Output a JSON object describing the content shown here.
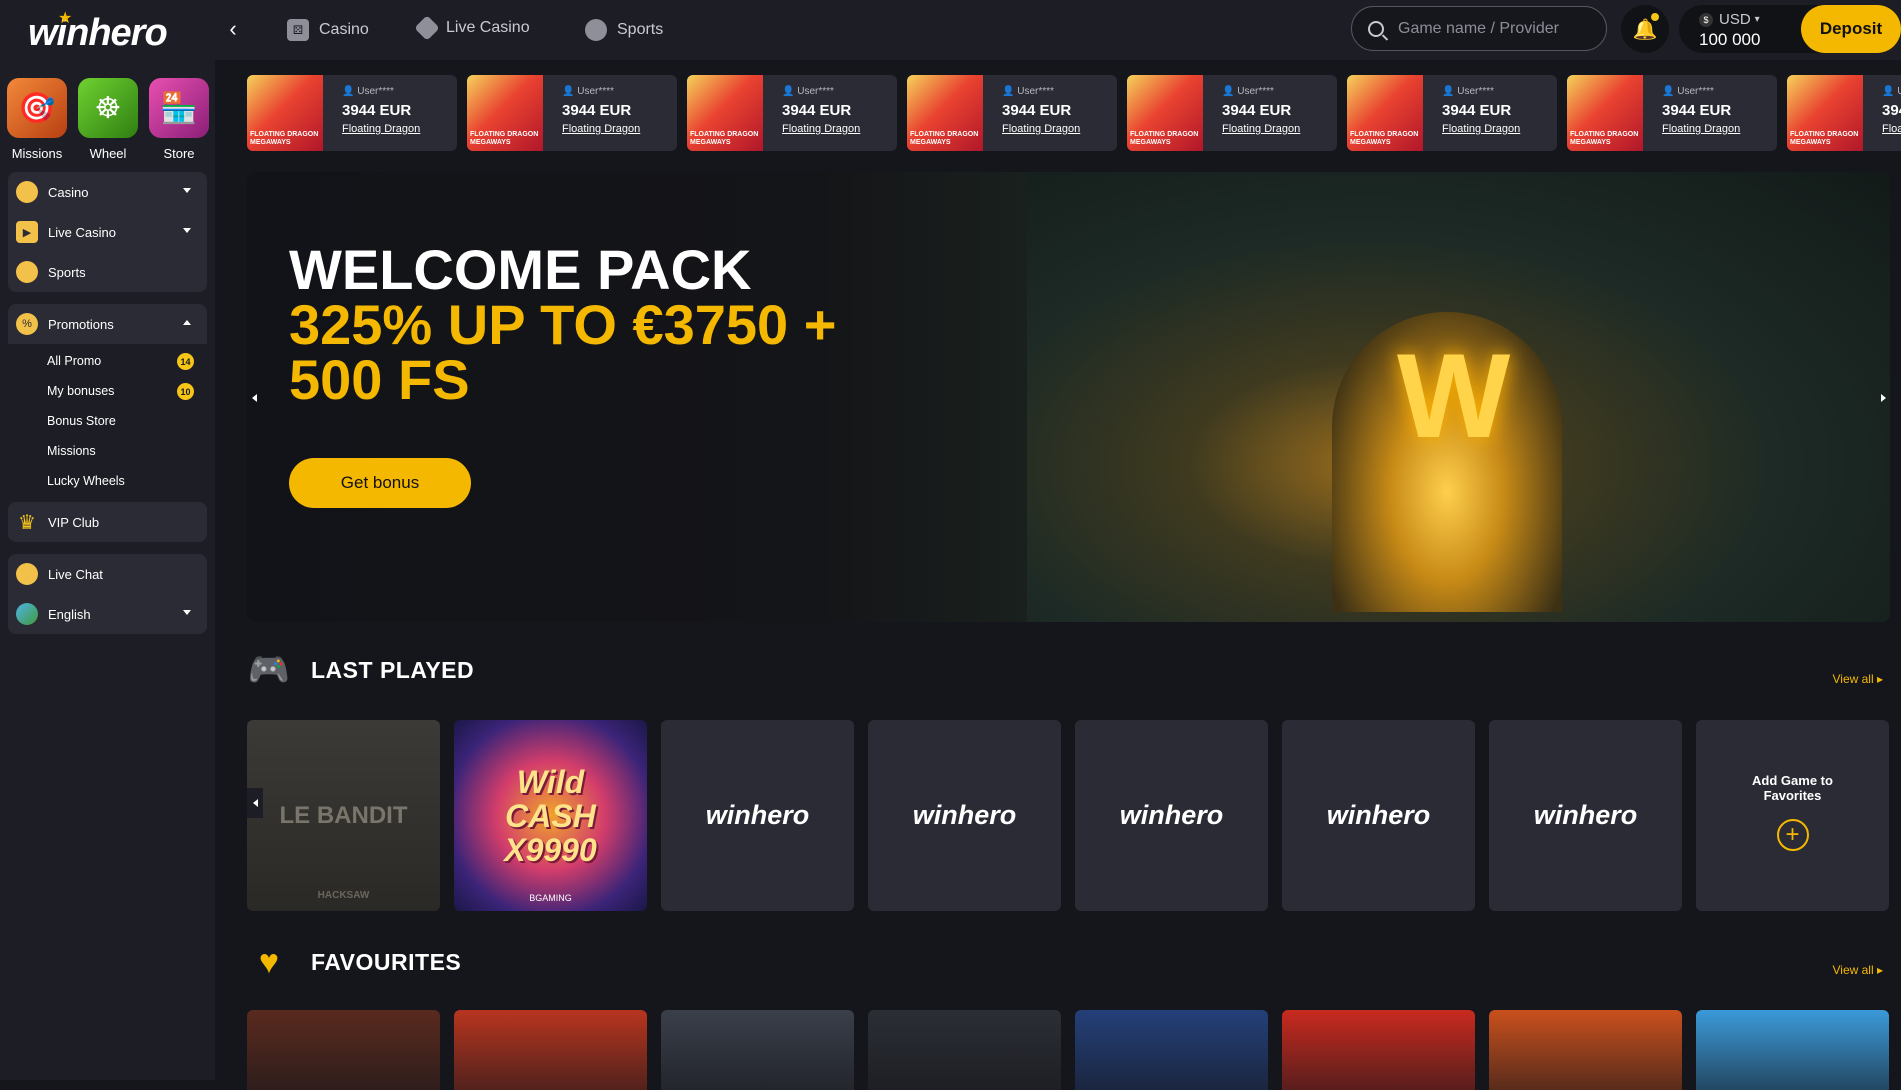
{
  "sidebar": {
    "logo": "winhero",
    "quick": [
      {
        "label": "Missions",
        "icon": "target-dart-icon"
      },
      {
        "label": "Wheel",
        "icon": "wheel-icon"
      },
      {
        "label": "Store",
        "icon": "store-icon"
      }
    ],
    "games_nav": [
      {
        "label": "Casino",
        "icon": "casino-icon"
      },
      {
        "label": "Live Casino",
        "icon": "play-icon"
      },
      {
        "label": "Sports",
        "icon": "ball-icon"
      }
    ],
    "promotions": {
      "label": "Promotions",
      "items": [
        {
          "label": "All Promo",
          "badge": "14"
        },
        {
          "label": "My bonuses",
          "badge": "10"
        },
        {
          "label": "Bonus Store",
          "badge": ""
        },
        {
          "label": "Missions",
          "badge": ""
        },
        {
          "label": "Lucky Wheels",
          "badge": ""
        }
      ]
    },
    "vip": "VIP Club",
    "live_chat": "Live Chat",
    "language": "English"
  },
  "header": {
    "tabs": [
      "Casino",
      "Live Casino",
      "Sports"
    ],
    "search_placeholder": "Game name / Provider",
    "currency": "USD",
    "balance": "100 000",
    "deposit": "Deposit"
  },
  "ticker": {
    "user": "User****",
    "amount": "3944 EUR",
    "game": "Floating Dragon",
    "thumb_text": "FLOATING DRAGON MEGAWAYS",
    "count": 8,
    "last_partial_amount": "39",
    "last_partial_game": "Floa"
  },
  "hero": {
    "line1": "WELCOME PACK",
    "line2": "325% UP TO €3750 + 500 FS",
    "cta": "Get bonus"
  },
  "last_played": {
    "title": "LAST PLAYED",
    "view_all": "View all",
    "cards": [
      {
        "type": "game",
        "title": "LE BANDIT",
        "provider": "HACKSAW"
      },
      {
        "type": "game",
        "title": "Wild CASH X9990",
        "provider": "BGAMING"
      },
      {
        "type": "placeholder",
        "brand": "winhero"
      },
      {
        "type": "placeholder",
        "brand": "winhero"
      },
      {
        "type": "placeholder",
        "brand": "winhero"
      },
      {
        "type": "placeholder",
        "brand": "winhero"
      },
      {
        "type": "placeholder",
        "brand": "winhero"
      },
      {
        "type": "add",
        "label": "Add Game to Favorites"
      }
    ]
  },
  "favourites": {
    "title": "FAVOURITES",
    "view_all": "View all",
    "colors": [
      "#5a2a1e",
      "#b8351f",
      "#3a3f4a",
      "#2b2e35",
      "#24407a",
      "#c92a1f",
      "#c9501c",
      "#3b9ad9"
    ]
  }
}
